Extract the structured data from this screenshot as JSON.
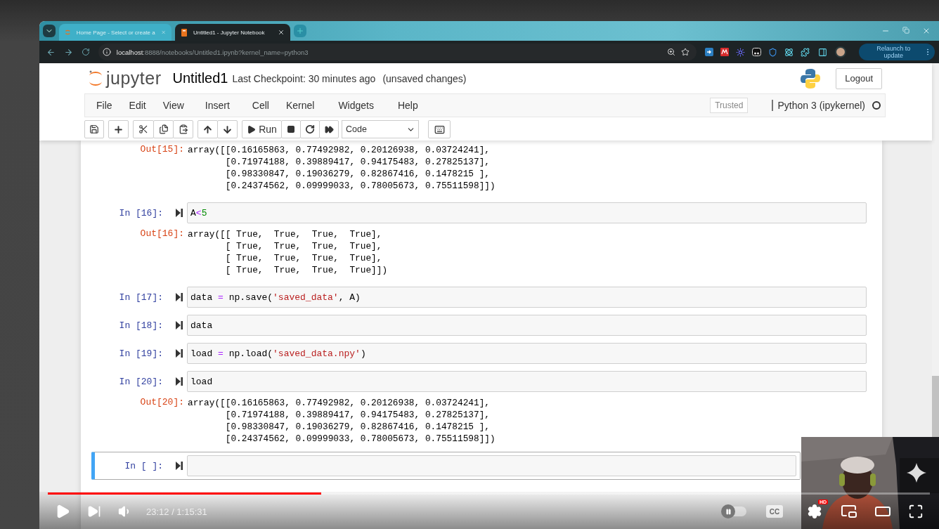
{
  "browser": {
    "tabs": [
      {
        "title": "Home Page - Select or create a",
        "selected": false
      },
      {
        "title": "Untitled1 - Jupyter Notebook",
        "selected": true
      }
    ],
    "address": {
      "host": "localhost",
      "path": ":8888/notebooks/Untitled1.ipynb?kernel_name=python3"
    },
    "update_button": "Relaunch to update"
  },
  "notebook": {
    "logo_text": "jupyter",
    "title": "Untitled1",
    "checkpoint": "Last Checkpoint: 30 minutes ago",
    "status": "(unsaved changes)",
    "logout": "Logout",
    "menu": [
      "File",
      "Edit",
      "View",
      "Insert",
      "Cell",
      "Kernel",
      "Widgets",
      "Help"
    ],
    "trusted": "Trusted",
    "kernel": "Python 3 (ipykernel)",
    "kernel_busy": false,
    "run_label": "Run",
    "cell_type": "Code",
    "cells": [
      {
        "selected": false,
        "output": {
          "prompt": "Out[15]:",
          "lines": [
            "array([[0.16165863, 0.77492982, 0.20126938, 0.03724241],",
            "       [0.71974188, 0.39889417, 0.94175483, 0.27825137],",
            "       [0.98330847, 0.19036279, 0.82867416, 0.1478215 ],",
            "       [0.24374562, 0.09999033, 0.78005673, 0.75511598]])"
          ]
        }
      },
      {
        "selected": false,
        "prompt": "In [16]:",
        "code": [
          {
            "text": "A",
            "kind": "plain"
          },
          {
            "text": "<",
            "kind": "operator"
          },
          {
            "text": "5",
            "kind": "number"
          }
        ],
        "output": {
          "prompt": "Out[16]:",
          "lines": [
            "array([[ True,  True,  True,  True],",
            "       [ True,  True,  True,  True],",
            "       [ True,  True,  True,  True],",
            "       [ True,  True,  True,  True]])"
          ]
        }
      },
      {
        "selected": false,
        "prompt": "In [17]:",
        "code": [
          {
            "text": "data ",
            "kind": "plain"
          },
          {
            "text": "=",
            "kind": "operator"
          },
          {
            "text": " np.save(",
            "kind": "plain"
          },
          {
            "text": "'saved_data'",
            "kind": "string"
          },
          {
            "text": ", A)",
            "kind": "plain"
          }
        ]
      },
      {
        "selected": false,
        "prompt": "In [18]:",
        "code": [
          {
            "text": "data",
            "kind": "plain"
          }
        ]
      },
      {
        "selected": false,
        "prompt": "In [19]:",
        "code": [
          {
            "text": "load ",
            "kind": "plain"
          },
          {
            "text": "=",
            "kind": "operator"
          },
          {
            "text": " np.load(",
            "kind": "plain"
          },
          {
            "text": "'saved_data.npy'",
            "kind": "string"
          },
          {
            "text": ")",
            "kind": "plain"
          }
        ]
      },
      {
        "selected": false,
        "prompt": "In [20]:",
        "code": [
          {
            "text": "load",
            "kind": "plain"
          }
        ],
        "output": {
          "prompt": "Out[20]:",
          "lines": [
            "array([[0.16165863, 0.77492982, 0.20126938, 0.03724241],",
            "       [0.71974188, 0.39889417, 0.94175483, 0.27825137],",
            "       [0.98330847, 0.19036279, 0.82867416, 0.1478215 ],",
            "       [0.24374562, 0.09999033, 0.78005673, 0.75511598]])"
          ]
        }
      },
      {
        "selected": true,
        "prompt": "In [ ]:"
      }
    ]
  },
  "player": {
    "paused": true,
    "level": 0.31,
    "time": "23:12 / 1:15:31",
    "autoplay": false,
    "cc": "CC",
    "hd_badge": "HD"
  }
}
